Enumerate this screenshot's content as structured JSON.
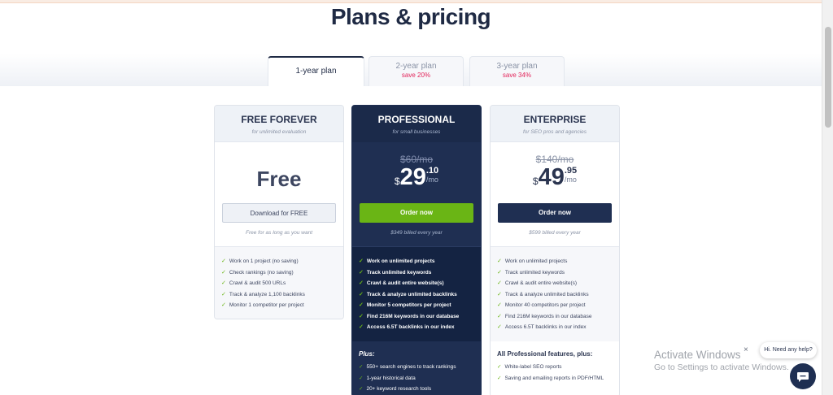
{
  "header": {
    "title": "Plans & pricing"
  },
  "tabs": [
    {
      "label": "1-year plan",
      "save": ""
    },
    {
      "label": "2-year plan",
      "save": "save 20%"
    },
    {
      "label": "3-year plan",
      "save": "save 34%"
    }
  ],
  "plans": {
    "free": {
      "name": "FREE FOREVER",
      "sub": "for unlimited evaluation",
      "price": "Free",
      "button": "Download for FREE",
      "note": "Free for as long as you want",
      "features": [
        "Work on 1 project (no saving)",
        "Check rankings (no saving)",
        "Crawl & audit 500 URLs",
        "Track & analyze 1,100 backlinks",
        "Monitor 1 competitor per project"
      ]
    },
    "pro": {
      "name": "PROFESSIONAL",
      "sub": "for small businesses",
      "old_price": "$60/mo",
      "currency": "$",
      "price_int": "29",
      "price_cents": ".10",
      "per": "/mo",
      "button": "Order now",
      "note": "$349 billed every year",
      "features": [
        "Work on unlimited projects",
        "Track unlimited keywords",
        "Crawl & audit entire website(s)",
        "Track & analyze unlimited backlinks",
        "Monitor 5 competitors per project",
        "Find 216M keywords in our database",
        "Access 6.5T backlinks in our index"
      ],
      "plus_title": "Plus:",
      "plus": [
        "550+ search engines to track rankings",
        "1-year historical data",
        "20+ keyword research tools"
      ]
    },
    "ent": {
      "name": "ENTERPRISE",
      "sub": "for SEO pros and agencies",
      "old_price": "$140/mo",
      "currency": "$",
      "price_int": "49",
      "price_cents": ".95",
      "per": "/mo",
      "button": "Order now",
      "note": "$599 billed every year",
      "features": [
        "Work on unlimited projects",
        "Track unlimited keywords",
        "Crawl & audit entire website(s)",
        "Track & analyze unlimited backlinks",
        "Monitor 40 competitors per project",
        "Find 216M keywords in our database",
        "Access 6.5T backlinks in our index"
      ],
      "plus_title": "All Professional features, plus:",
      "plus": [
        "White-label SEO reports",
        "Saving and emailing reports in PDF/HTML"
      ]
    }
  },
  "watermark": {
    "title": "Activate Windows",
    "sub": "Go to Settings to activate Windows."
  },
  "chat": {
    "bubble": "Hi. Need any help?",
    "close": "×"
  },
  "icons": {
    "check": "✓"
  }
}
